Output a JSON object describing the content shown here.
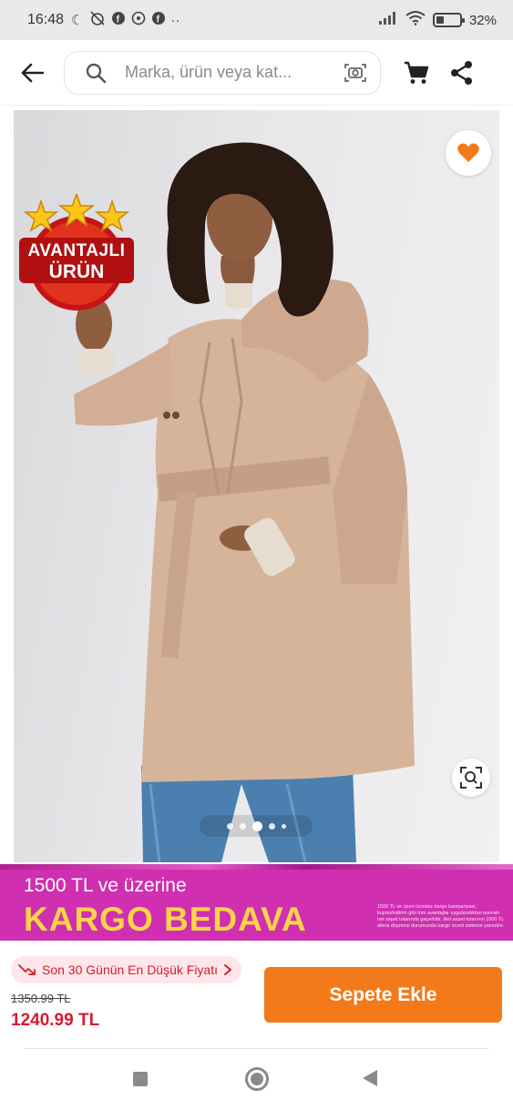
{
  "status_bar": {
    "time": "16:48",
    "extra_dots": "··",
    "battery_percent": "32%"
  },
  "header": {
    "search_placeholder": "Marka, ürün veya kat...",
    "icons": [
      "back-arrow-icon",
      "search-icon",
      "camera-search-icon",
      "cart-icon",
      "share-icon"
    ]
  },
  "product": {
    "badge_line1": "AVANTAJLI",
    "badge_line2": "ÜRÜN",
    "image_count": 5,
    "active_image_index": 2,
    "favorite_color": "#f27a1a"
  },
  "campaign": {
    "line1": "1500 TL ve üzerine",
    "line2": "KARGO BEDAVA",
    "fine_print": "1500 TL ve üzeri ücretsiz kargo kampanyası, kupon/indirim gibi tüm avantajlar uygulandıktan sonraki net sepet tutarında geçerlidir. Net sepet tutarının 1500 TL altına düşmesi durumunda kargo ücreti sisteme yansıtılır."
  },
  "purchase": {
    "lowest_price_label": "Son 30 Günün En Düşük Fiyatı",
    "old_price": "1350.99 TL",
    "new_price": "1240.99 TL",
    "add_to_cart_label": "Sepete Ekle"
  },
  "colors": {
    "accent": "#f27a1a",
    "price_red": "#d71a2e",
    "campaign_magenta": "#cf2fb0",
    "campaign_yellow": "#ffd44a"
  }
}
